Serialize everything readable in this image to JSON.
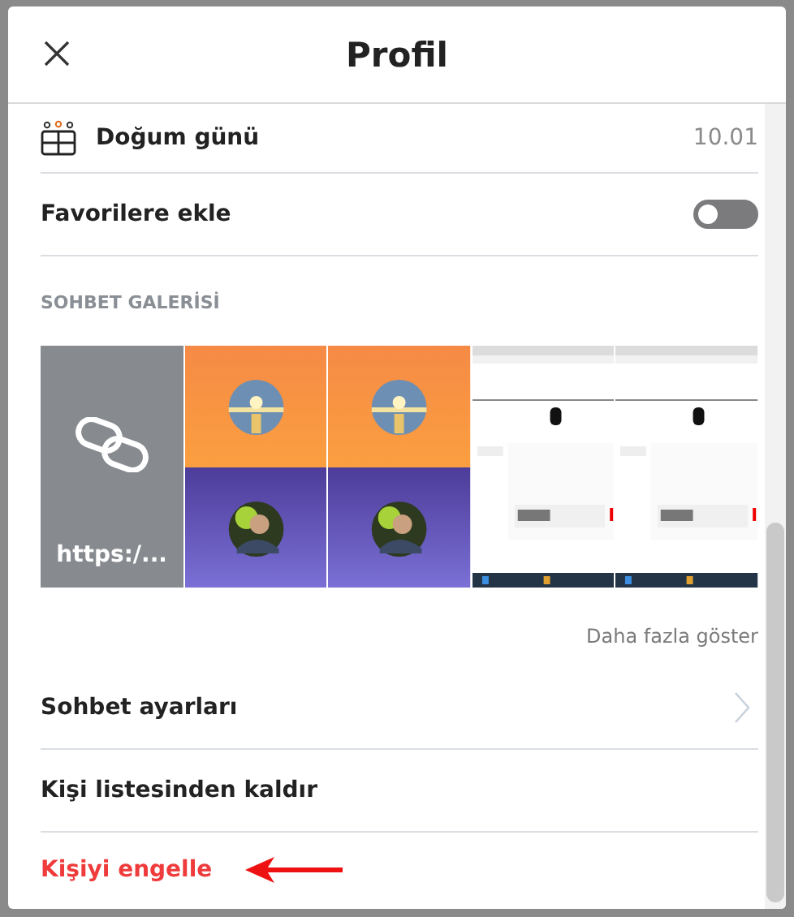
{
  "dialog": {
    "title": "Profil"
  },
  "birthday": {
    "label": "Doğum günü",
    "value": "10.01"
  },
  "favorite": {
    "label": "Favorilere ekle",
    "on": false
  },
  "gallery": {
    "heading": "SOHBET GALERİSİ",
    "tiles": [
      {
        "kind": "link",
        "text": "https:/..."
      },
      {
        "kind": "avatars"
      },
      {
        "kind": "avatars"
      },
      {
        "kind": "screenshot"
      },
      {
        "kind": "screenshot"
      }
    ],
    "more": "Daha fazla göster"
  },
  "actions": [
    {
      "label": "Sohbet ayarları",
      "kind": "nav"
    },
    {
      "label": "Kişi listesinden kaldır",
      "kind": "plain"
    },
    {
      "label": "Kişiyi engelle",
      "kind": "danger"
    }
  ]
}
